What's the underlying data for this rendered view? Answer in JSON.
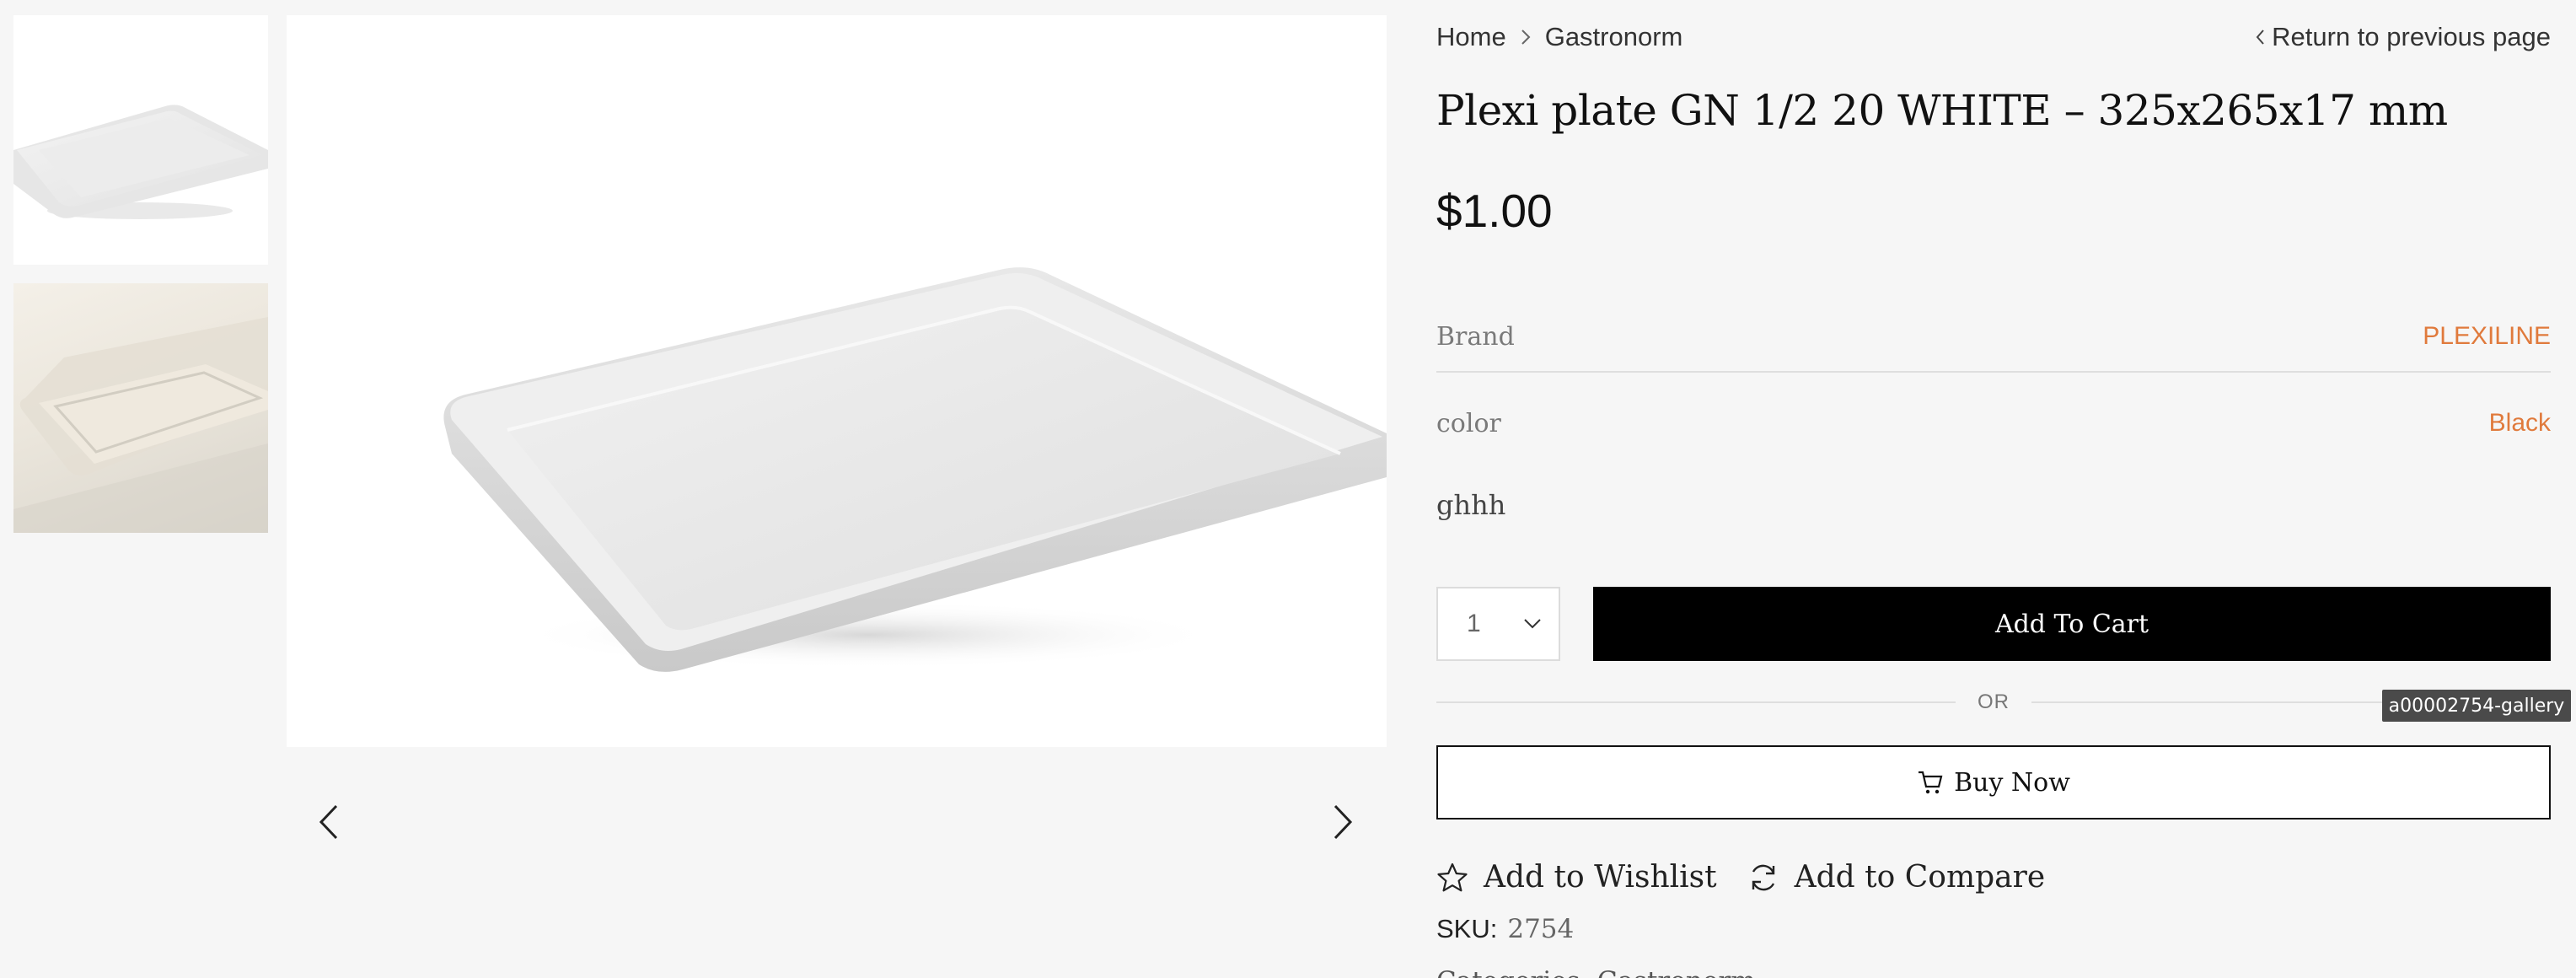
{
  "breadcrumb": {
    "home": "Home",
    "category": "Gastronorm"
  },
  "return_link": "Return to previous page",
  "product": {
    "title": "Plexi plate GN 1/2 20 WHITE – 325x265x17 mm",
    "price": "$1.00",
    "attributes": [
      {
        "label": "Brand",
        "value": "PLEXILINE"
      },
      {
        "label": "color",
        "value": "Black"
      }
    ],
    "description": "ghhh",
    "sku_label": "SKU:",
    "sku_value": "2754",
    "categories_partial": "Categories: Gastronorm"
  },
  "cart": {
    "quantity": "1",
    "add_to_cart": "Add To Cart",
    "or": "OR",
    "buy_now": "Buy Now"
  },
  "actions": {
    "wishlist": "Add to Wishlist",
    "compare": "Add to Compare"
  },
  "tooltip": "a00002754-gallery",
  "gallery": {
    "thumbnails": [
      "tray-thumbnail-1",
      "tray-thumbnail-2"
    ],
    "main_image": "white-plexi-tray"
  },
  "colors": {
    "accent": "#e07a3c",
    "button_dark": "#000000",
    "background": "#f6f6f6"
  }
}
